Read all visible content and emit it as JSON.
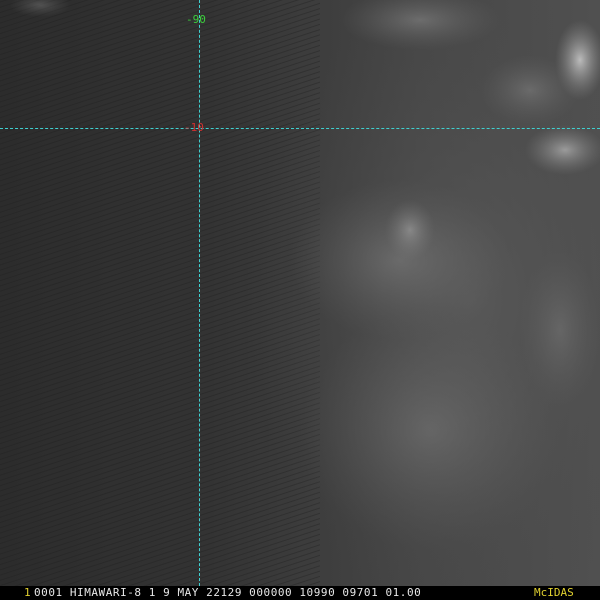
{
  "grid": {
    "longitude_label": "-90",
    "latitude_label": "-10",
    "line_color": "#3fd0d0",
    "longitude_label_color": "#3ccf3c",
    "latitude_label_color": "#d03030"
  },
  "status_bar": {
    "frame_number": "1",
    "text": "0001 HIMAWARI-8  1  9 MAY 22129 000000 10990 09701 01.00",
    "software": "McIDAS",
    "highlight_color": "#e0d030"
  }
}
